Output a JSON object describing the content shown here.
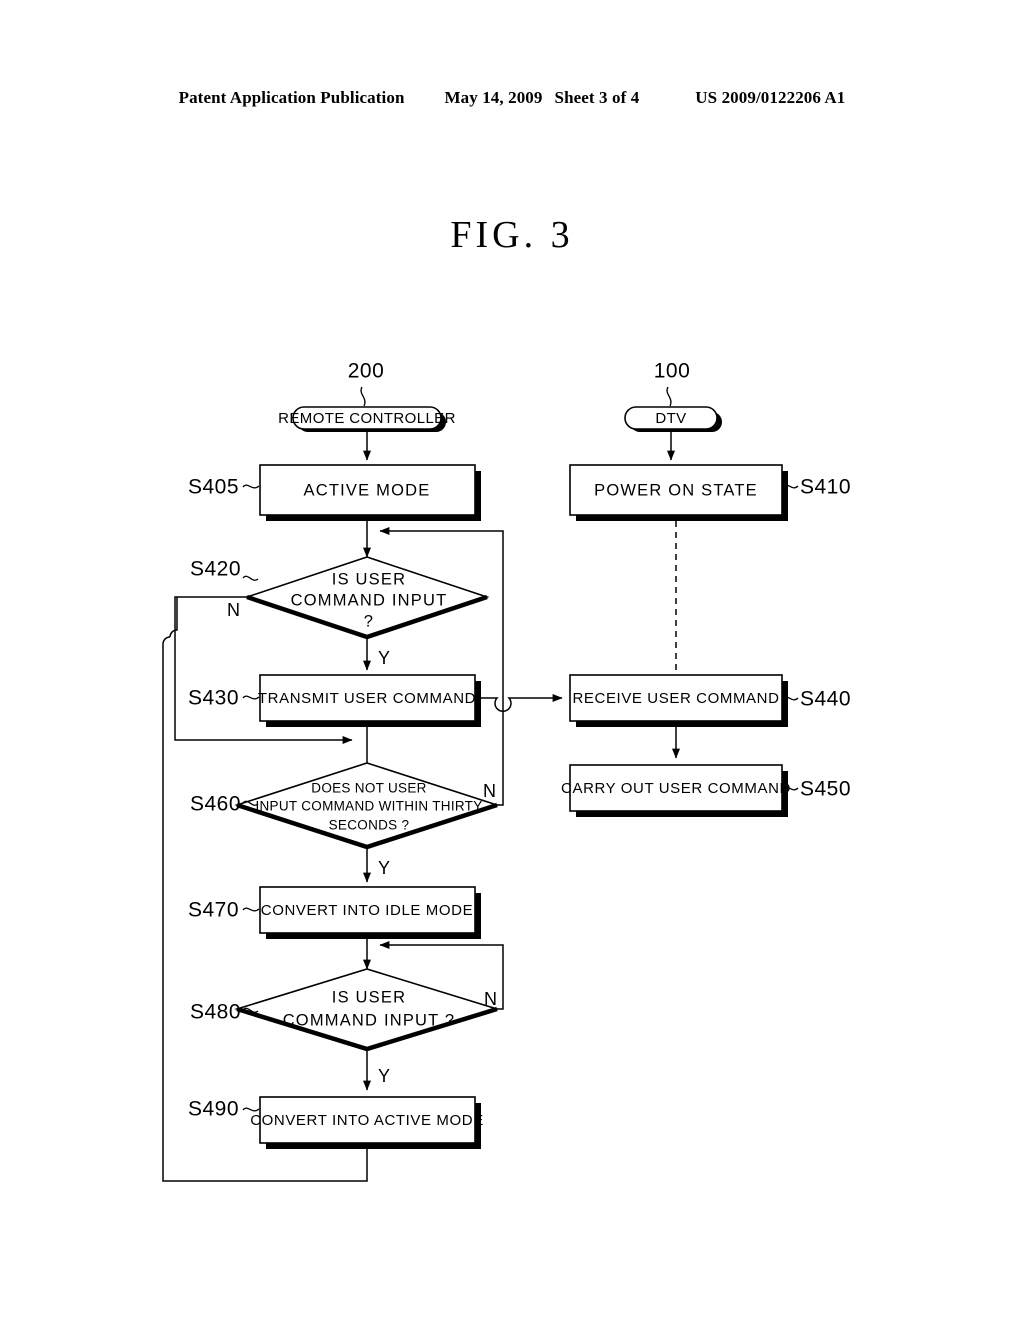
{
  "header": {
    "publication": "Patent Application Publication",
    "date": "May 14, 2009",
    "sheet": "Sheet 3 of 4",
    "patent_number": "US 2009/0122206 A1"
  },
  "figure": {
    "title": "FIG.  3"
  },
  "diagram": {
    "type": "flowchart",
    "columns": [
      {
        "id": "remote-controller",
        "ref": "200",
        "terminal_label": "REMOTE CONTROLLER"
      },
      {
        "id": "dtv",
        "ref": "100",
        "terminal_label": "DTV"
      }
    ],
    "nodes": [
      {
        "id": "s405",
        "step": "S405",
        "shape": "process",
        "label": "ACTIVE MODE",
        "column": "remote-controller"
      },
      {
        "id": "s410",
        "step": "S410",
        "shape": "process",
        "label": "POWER ON STATE",
        "column": "dtv"
      },
      {
        "id": "s420",
        "step": "S420",
        "shape": "decision",
        "label_lines": [
          "IS USER",
          "COMMAND INPUT",
          "?"
        ],
        "column": "remote-controller",
        "branch_yes": "Y",
        "branch_no": "N"
      },
      {
        "id": "s430",
        "step": "S430",
        "shape": "process",
        "label": "TRANSMIT USER COMMAND",
        "column": "remote-controller"
      },
      {
        "id": "s440",
        "step": "S440",
        "shape": "process",
        "label": "RECEIVE USER COMMAND",
        "column": "dtv"
      },
      {
        "id": "s450",
        "step": "S450",
        "shape": "process",
        "label": "CARRY OUT USER COMMAND",
        "column": "dtv"
      },
      {
        "id": "s460",
        "step": "S460",
        "shape": "decision",
        "label_lines": [
          "DOES NOT USER",
          "INPUT COMMAND WITHIN THIRTY",
          "SECONDS ?"
        ],
        "column": "remote-controller",
        "branch_yes": "Y",
        "branch_no": "N"
      },
      {
        "id": "s470",
        "step": "S470",
        "shape": "process",
        "label": "CONVERT INTO IDLE MODE",
        "column": "remote-controller"
      },
      {
        "id": "s480",
        "step": "S480",
        "shape": "decision",
        "label_lines": [
          "IS USER",
          "COMMAND INPUT ?"
        ],
        "column": "remote-controller",
        "branch_yes": "Y",
        "branch_no": "N"
      },
      {
        "id": "s490",
        "step": "S490",
        "shape": "process",
        "label": "CONVERT INTO ACTIVE MODE",
        "column": "remote-controller"
      }
    ]
  }
}
